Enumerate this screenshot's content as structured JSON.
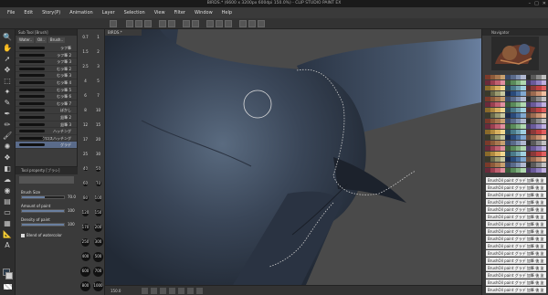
{
  "window": {
    "title": "BIRDS.* (6600 x 3200px 600dpi 150.0%) - CLIP STUDIO PAINT EX",
    "controls": [
      "–",
      "□",
      "✕"
    ]
  },
  "menu": [
    "File",
    "Edit",
    "Story(P)",
    "Animation",
    "Layer",
    "Selection",
    "View",
    "Filter",
    "Window",
    "Help"
  ],
  "subtool": {
    "panel_title": "Sub Tool [Brush]",
    "tabs": [
      "Water..",
      "Oil..",
      "Brush.."
    ],
    "brushes": [
      {
        "label": "ラフ筆",
        "selected": false
      },
      {
        "label": "ラフ筆 2",
        "selected": false
      },
      {
        "label": "ラフ筆 3",
        "selected": false
      },
      {
        "label": "むラ筆 2",
        "selected": false
      },
      {
        "label": "むラ筆 3",
        "selected": false
      },
      {
        "label": "むラ筆 4",
        "selected": false
      },
      {
        "label": "むラ筆 5",
        "selected": false
      },
      {
        "label": "むラ筆 6",
        "selected": false
      },
      {
        "label": "むラ筆 7",
        "selected": false
      },
      {
        "label": "ぼかし",
        "selected": false
      },
      {
        "label": "鉛筆 2",
        "selected": false
      },
      {
        "label": "鉛筆 3",
        "selected": false
      },
      {
        "label": "ハッチング",
        "selected": false
      },
      {
        "label": "クロスハッチング",
        "selected": false
      },
      {
        "label": "グラデ",
        "selected": true
      }
    ]
  },
  "tool_property": {
    "header": "Tool property [ブラシ]",
    "name": "ブラシ",
    "props": [
      {
        "label": "Brush Size",
        "value": "70.0",
        "fill": 0.55
      },
      {
        "label": "Amount of paint",
        "value": "100",
        "fill": 1.0
      },
      {
        "label": "Density of paint",
        "value": "100",
        "fill": 1.0
      }
    ],
    "blend_label": "Blend of watercolor"
  },
  "brush_sizes": [
    [
      "0.7",
      "1"
    ],
    [
      "1.5",
      "2"
    ],
    [
      "2.5",
      "3"
    ],
    [
      "4",
      "5"
    ],
    [
      "6",
      "7"
    ],
    [
      "8",
      "10"
    ],
    [
      "12",
      "15"
    ],
    [
      "17",
      "20"
    ],
    [
      "25",
      "30"
    ],
    [
      "40",
      "50"
    ],
    [
      "60",
      "70"
    ],
    [
      "80",
      "100"
    ],
    [
      "120",
      "150"
    ],
    [
      "170",
      "200"
    ],
    [
      "250",
      "300"
    ],
    [
      "400",
      "500"
    ],
    [
      "600",
      "700"
    ],
    [
      "800",
      "1000"
    ]
  ],
  "canvas": {
    "tab": "BIRDS.*",
    "zoom": "150.0"
  },
  "navigator": {
    "title": "Navigator"
  },
  "colors": {
    "swatches": [
      "#7a3a2a",
      "#8c5a3a",
      "#a87850",
      "#c8a070",
      "#3a4a6a",
      "#5a6a8a",
      "#8090b0",
      "#b0b8d0",
      "#2a2a2a",
      "#5a5a5a",
      "#8a8a8a",
      "#c0c0c0",
      "#6a2a3a",
      "#9a4050",
      "#c06070",
      "#e090a0",
      "#3a5a3a",
      "#5a8a5a",
      "#80b080",
      "#b0d8b0",
      "#4a3a6a",
      "#6a5a9a",
      "#9080c0",
      "#c0b0e0",
      "#8a6a2a",
      "#b08a40",
      "#d8b060",
      "#f0d890",
      "#2a4a5a",
      "#4a7a8a",
      "#70a0b0",
      "#a0d0e0",
      "#5a2a2a",
      "#8a3a3a",
      "#c04040",
      "#e06060",
      "#3a3a2a",
      "#6a6a4a",
      "#9a9a70",
      "#c8c8a0",
      "#1a2a4a",
      "#2a4a7a",
      "#4a70a0",
      "#80a8d0",
      "#6a4a3a",
      "#9a6a50",
      "#c89070",
      "#f0c0a0"
    ],
    "accent": "#5a6b8a"
  },
  "layers": [
    "BrushOil paint グラデ 加筆 後 塗",
    "BrushOil paint グラデ 加筆 後 塗",
    "BrushOil paint グラデ 加筆 後 塗",
    "BrushOil paint グラデ 加筆 後 塗",
    "BrushOil paint グラデ 加筆 後 塗",
    "BrushOil paint グラデ 加筆 後 塗",
    "BrushOil paint グラデ 加筆 後 塗",
    "BrushOil paint グラデ 加筆 後 塗",
    "BrushOil paint グラデ 加筆 後 塗",
    "BrushOil paint グラデ 加筆 後 塗",
    "BrushOil paint グラデ 加筆 後 塗",
    "BrushOil paint グラデ 加筆 後 塗",
    "BrushOil paint グラデ 加筆 後 塗",
    "BrushOil paint グラデ 加筆 後 塗",
    "BrushOil paint グラデ 加筆 後 塗",
    "BrushOil paint グラデ 加筆 後 塗"
  ]
}
